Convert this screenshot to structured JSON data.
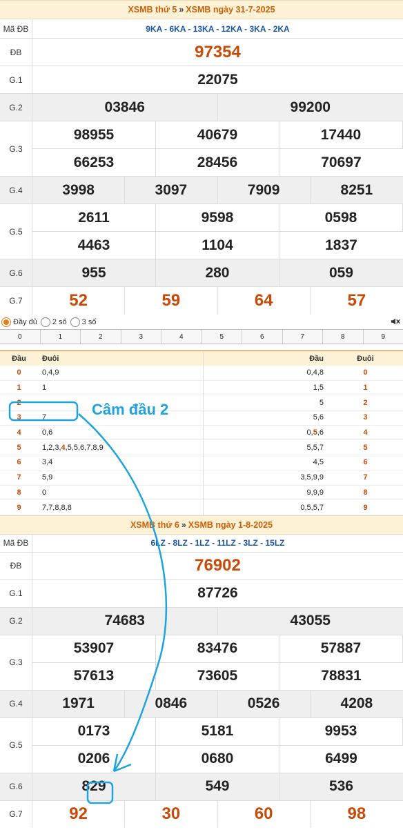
{
  "draw1": {
    "header": {
      "left": "XSMB thứ 5",
      "sep": "»",
      "right": "XSMB ngày 31-7-2025"
    },
    "madb_label": "Mã ĐB",
    "madb": "9KA - 6KA - 13KA - 12KA - 3KA - 2KA",
    "prizes": [
      {
        "label": "ĐB",
        "values": [
          "97354"
        ]
      },
      {
        "label": "G.1",
        "values": [
          "22075"
        ]
      },
      {
        "label": "G.2",
        "values": [
          "03846",
          "99200"
        ]
      },
      {
        "label": "G.3",
        "values": [
          "98955",
          "40679",
          "17440",
          "66253",
          "28456",
          "70697"
        ]
      },
      {
        "label": "G.4",
        "values": [
          "3998",
          "3097",
          "7909",
          "8251"
        ]
      },
      {
        "label": "G.5",
        "values": [
          "2611",
          "9598",
          "0598",
          "4463",
          "1104",
          "1837"
        ]
      },
      {
        "label": "G.6",
        "values": [
          "955",
          "280",
          "059"
        ]
      },
      {
        "label": "G.7",
        "values": [
          "52",
          "59",
          "64",
          "57"
        ]
      }
    ]
  },
  "options": {
    "full": "Đầy đủ",
    "two": "2 số",
    "three": "3 số"
  },
  "digits": [
    "0",
    "1",
    "2",
    "3",
    "4",
    "5",
    "6",
    "7",
    "8",
    "9"
  ],
  "dau_duoi": {
    "headers": {
      "dau": "Đầu",
      "duoi": "Đuôi",
      "dau2": "Đầu",
      "duoi2": "Đuôi"
    },
    "rows": [
      {
        "k": "0",
        "dau_tail": "0,4,9",
        "duoi_head": "0,4,8",
        "k2": "0"
      },
      {
        "k": "1",
        "dau_tail": "1",
        "duoi_head": "1,5",
        "k2": "1"
      },
      {
        "k": "2",
        "dau_tail": "",
        "duoi_head": "5",
        "k2": "2"
      },
      {
        "k": "3",
        "dau_tail": "7",
        "duoi_head": "5,6",
        "k2": "3"
      },
      {
        "k": "4",
        "dau_tail": "0,6",
        "duoi_head_a": "0,",
        "duoi_head_hl": "5",
        "duoi_head_b": ",6",
        "k2": "4"
      },
      {
        "k": "5",
        "dau_tail_a": "1,2,3,",
        "dau_tail_hl": "4",
        "dau_tail_b": ",5,5,6,7,8,9",
        "duoi_head": "5,5,7",
        "k2": "5"
      },
      {
        "k": "6",
        "dau_tail": "3,4",
        "duoi_head": "4,5",
        "k2": "6"
      },
      {
        "k": "7",
        "dau_tail": "5,9",
        "duoi_head": "3,5,9,9",
        "k2": "7"
      },
      {
        "k": "8",
        "dau_tail": "0",
        "duoi_head": "9,9,9",
        "k2": "8"
      },
      {
        "k": "9",
        "dau_tail": "7,7,8,8,8",
        "duoi_head": "0,5,5,7",
        "k2": "9"
      }
    ]
  },
  "annotation": "Câm đầu 2",
  "draw2": {
    "header": {
      "left": "XSMB thứ 6",
      "sep": "»",
      "right": "XSMB ngày 1-8-2025"
    },
    "madb_label": "Mã ĐB",
    "madb": "6LZ - 8LZ - 1LZ - 11LZ - 3LZ - 15LZ",
    "prizes": [
      {
        "label": "ĐB",
        "values": [
          "76902"
        ]
      },
      {
        "label": "G.1",
        "values": [
          "87726"
        ]
      },
      {
        "label": "G.2",
        "values": [
          "74683",
          "43055"
        ]
      },
      {
        "label": "G.3",
        "values": [
          "53907",
          "83476",
          "57887",
          "57613",
          "73605",
          "78831"
        ]
      },
      {
        "label": "G.4",
        "values": [
          "1971",
          "0846",
          "0526",
          "4208"
        ]
      },
      {
        "label": "G.5",
        "values": [
          "0173",
          "5181",
          "9953",
          "0206",
          "0680",
          "6499"
        ]
      },
      {
        "label": "G.6",
        "values": [
          "829",
          "549",
          "536"
        ]
      },
      {
        "label": "G.7",
        "values": [
          "92",
          "30",
          "60",
          "98"
        ]
      }
    ]
  }
}
